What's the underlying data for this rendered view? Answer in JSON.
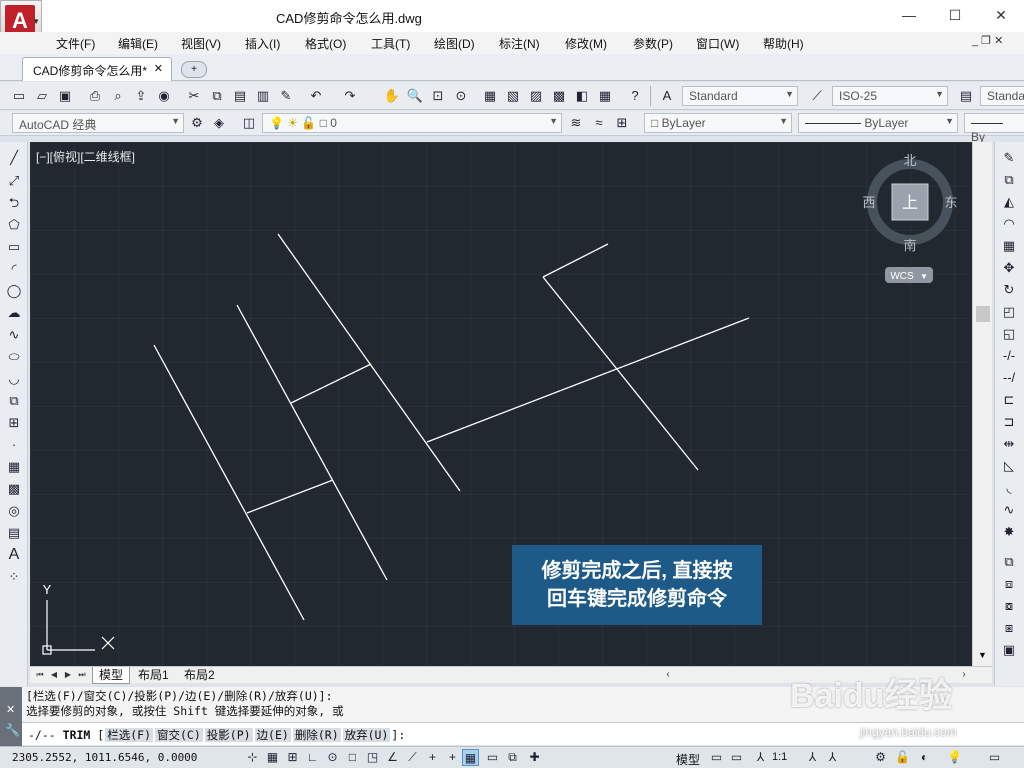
{
  "window": {
    "title": "CAD修剪命令怎么用.dwg",
    "minimize": "—",
    "maximize": "☐",
    "close": "✕",
    "app_logo": "A"
  },
  "menu": {
    "items": [
      "文件(F)",
      "编辑(E)",
      "视图(V)",
      "插入(I)",
      "格式(O)",
      "工具(T)",
      "绘图(D)",
      "标注(N)",
      "修改(M)",
      "参数(P)",
      "窗口(W)",
      "帮助(H)"
    ],
    "mdi_controls": "_ ❐ ✕"
  },
  "tabs": {
    "active": "CAD修剪命令怎么用*",
    "close": "✕",
    "new_tab": "+"
  },
  "toolbar1": {
    "text_style": "Standard",
    "dim_style": "ISO-25",
    "table_style": "Standa"
  },
  "toolbar2": {
    "workspace": "AutoCAD 经典",
    "layer": "0",
    "color": "ByLayer",
    "linetype": "ByLayer",
    "lineweight": "By"
  },
  "viewport": {
    "label": "[−][俯视][二维线框]",
    "compass": {
      "north": "北",
      "south": "南",
      "east": "东",
      "west": "西",
      "center": "上"
    },
    "wcs": "WCS",
    "ucs": {
      "y": "Y"
    }
  },
  "layout_tabs": [
    "模型",
    "布局1",
    "布局2"
  ],
  "command": {
    "history": [
      "[栏选(F)/窗交(C)/投影(P)/边(E)/删除(R)/放弃(U)]:",
      "选择要修剪的对象, 或按住 Shift 键选择要延伸的对象, 或"
    ],
    "prompt_cmd": "TRIM",
    "options": [
      "栏选(F)",
      "窗交(C)",
      "投影(P)",
      "边(E)",
      "删除(R)",
      "放弃(U)"
    ],
    "prompt_open": "[",
    "prompt_close": "]:"
  },
  "status": {
    "coords": "2305.2552, 1011.6546, 0.0000",
    "model": "模型",
    "scale": "1:1"
  },
  "caption": {
    "line1": "修剪完成之后, 直接按",
    "line2": "回车键完成修剪命令"
  },
  "watermark": {
    "main": "Baidu经验",
    "sub": "jingyan.baidu.com"
  },
  "colors": {
    "viewport_bg": "#212830",
    "grid": "#2c3540",
    "line": "#ffffff",
    "caption_bg": "#1e5a87"
  }
}
